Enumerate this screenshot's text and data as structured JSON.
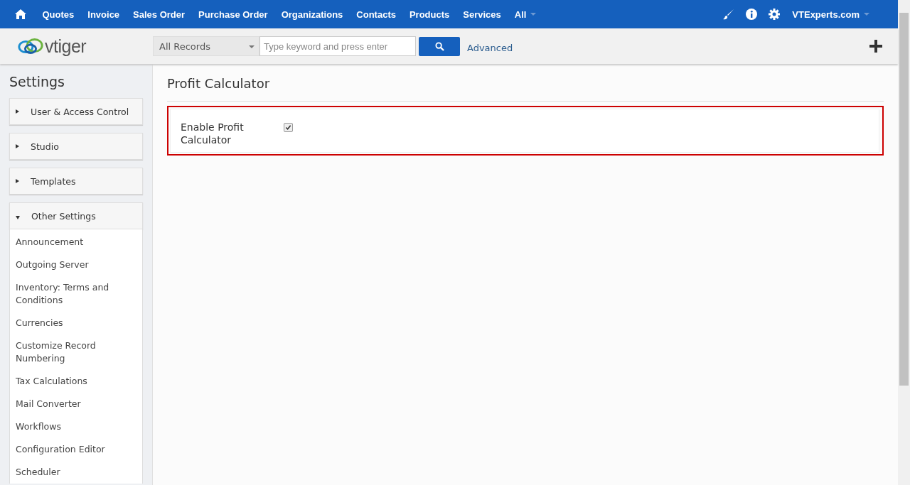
{
  "top_nav": {
    "items": [
      "Quotes",
      "Invoice",
      "Sales Order",
      "Purchase Order",
      "Organizations",
      "Contacts",
      "Products",
      "Services"
    ],
    "more_menu": "All",
    "user_menu": "VTExperts.com"
  },
  "header": {
    "logo": "vtiger",
    "search_scope": "All Records",
    "search": {
      "placeholder": "Type keyword and press enter"
    },
    "advanced_link": "Advanced"
  },
  "sidebar": {
    "title": "Settings",
    "sections": [
      {
        "label": "User & Access Control",
        "expanded": false
      },
      {
        "label": "Studio",
        "expanded": false
      },
      {
        "label": "Templates",
        "expanded": false
      },
      {
        "label": "Other Settings",
        "expanded": true,
        "items": [
          "Announcement",
          "Outgoing Server",
          "Inventory: Terms and Conditions",
          "Currencies",
          "Customize Record Numbering",
          "Tax Calculations",
          "Mail Converter",
          "Workflows",
          "Configuration Editor",
          "Scheduler"
        ]
      }
    ]
  },
  "main": {
    "title": "Profit Calculator",
    "setting": {
      "label": "Enable Profit Calculator",
      "checked": true
    }
  }
}
